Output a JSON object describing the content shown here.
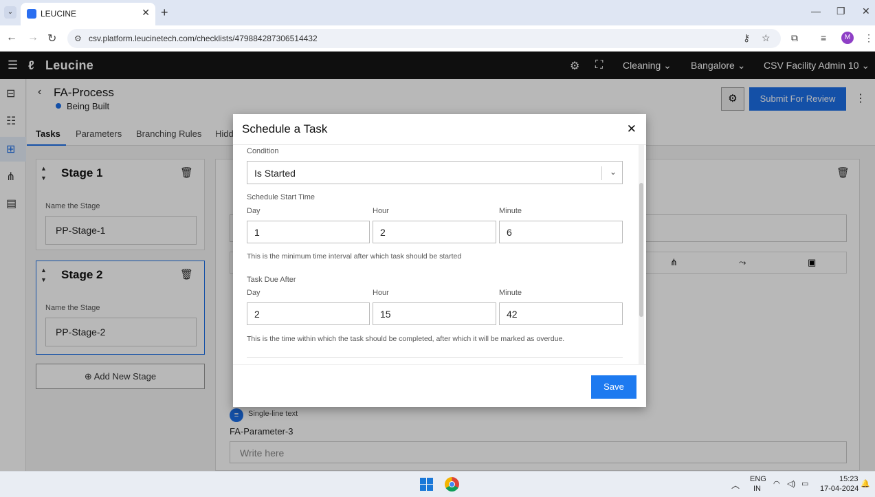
{
  "browser": {
    "tab_title": "LEUCINE",
    "url": "csv.platform.leucinetech.com/checklists/479884287306514432",
    "profile_initial": "M"
  },
  "app": {
    "logo_text": "Leucine",
    "header": {
      "use_case": "Cleaning",
      "facility": "Bangalore",
      "user": "CSV Facility Admin 10"
    }
  },
  "process": {
    "name": "FA-Process",
    "status": "Being Built",
    "submit_label": "Submit For Review",
    "tabs": [
      "Tasks",
      "Parameters",
      "Branching Rules",
      "Hidd"
    ]
  },
  "stages": [
    {
      "title": "Stage 1",
      "label": "Name the Stage",
      "value": "PP-Stage-1"
    },
    {
      "title": "Stage 2",
      "label": "Name the Stage",
      "value": "PP-Stage-2"
    }
  ],
  "add_stage_label": "Add New Stage",
  "parameter": {
    "type": "Single-line text",
    "name": "FA-Parameter-3",
    "placeholder": "Write here"
  },
  "modal": {
    "title": "Schedule a Task",
    "condition_label": "Condition",
    "condition_value": "Is Started",
    "start_time": {
      "section_label": "Schedule Start Time",
      "day_label": "Day",
      "day": "1",
      "hour_label": "Hour",
      "hour": "2",
      "minute_label": "Minute",
      "minute": "6",
      "help": "This is the minimum time interval after which task should be started"
    },
    "due_after": {
      "section_label": "Task Due After",
      "day_label": "Day",
      "day": "2",
      "hour_label": "Hour",
      "hour": "15",
      "minute_label": "Minute",
      "minute": "42",
      "help": "This is the time within which the task should be completed, after which it will be marked as overdue."
    },
    "save_label": "Save"
  },
  "taskbar": {
    "lang_top": "ENG",
    "lang_bottom": "IN",
    "time": "15:23",
    "date": "17-04-2024"
  },
  "colors": {
    "primary": "#1d6fe8",
    "header_bg": "#151515"
  }
}
